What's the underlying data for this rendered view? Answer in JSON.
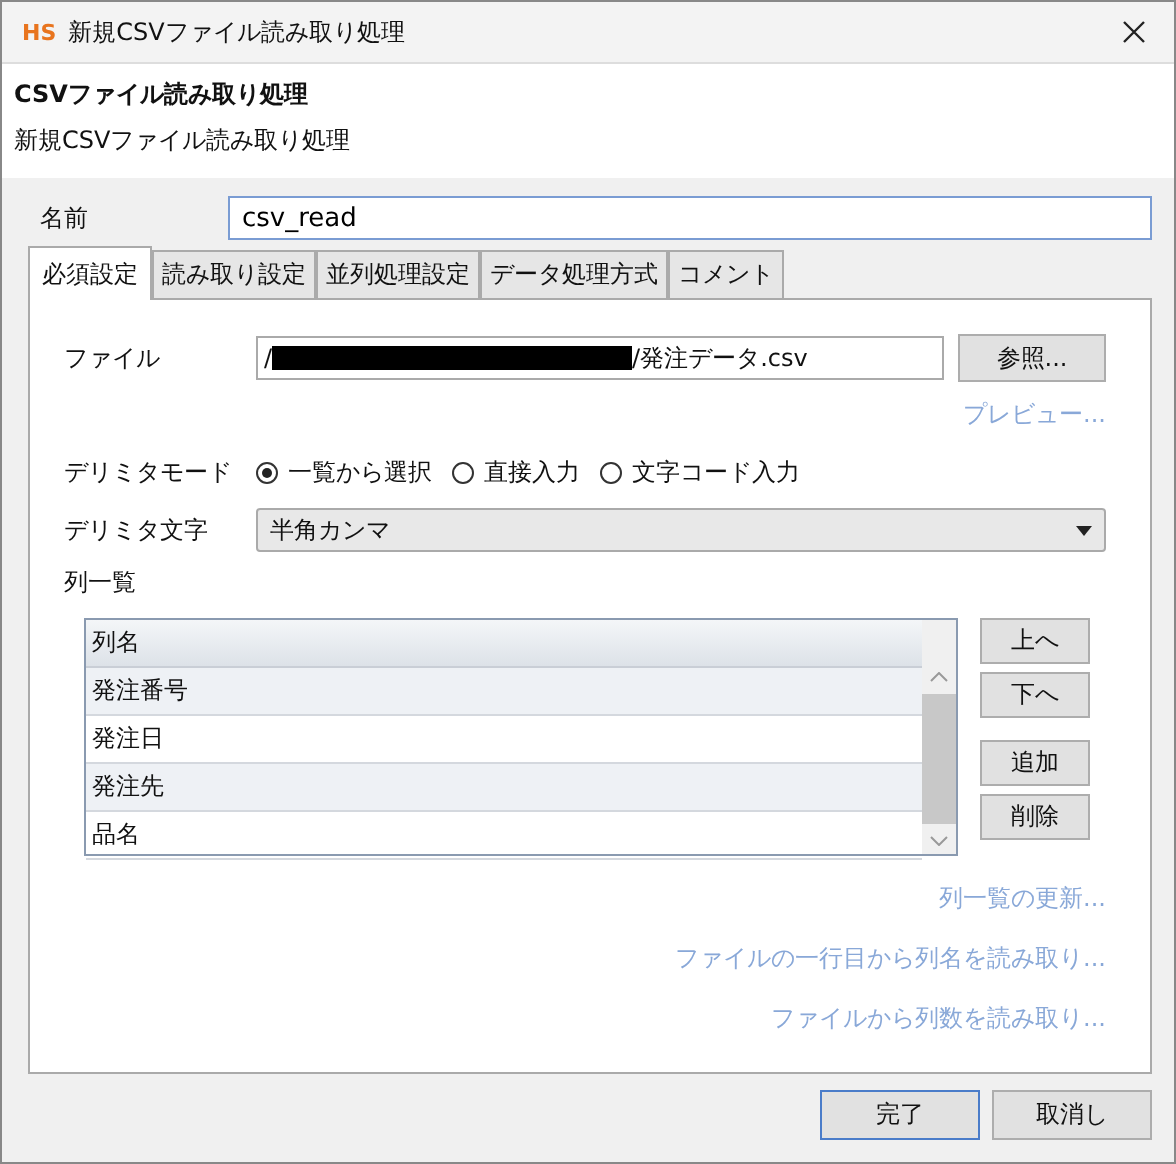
{
  "window": {
    "app_badge": "HS",
    "title": "新規CSVファイル読み取り処理"
  },
  "header": {
    "title": "CSVファイル読み取り処理",
    "subtitle": "新規CSVファイル読み取り処理"
  },
  "name_field": {
    "label": "名前",
    "value": "csv_read"
  },
  "tabs": [
    {
      "label": "必須設定",
      "selected": true
    },
    {
      "label": "読み取り設定",
      "selected": false
    },
    {
      "label": "並列処理設定",
      "selected": false
    },
    {
      "label": "データ処理方式",
      "selected": false
    },
    {
      "label": "コメント",
      "selected": false
    }
  ],
  "file": {
    "label": "ファイル",
    "value_start": "/",
    "redacted": true,
    "value_end": "/発注データ.csv",
    "browse_button": "参照...",
    "preview_link": "プレビュー..."
  },
  "delimiter_mode": {
    "label": "デリミタモード",
    "options": [
      {
        "label": "一覧から選択",
        "selected": true
      },
      {
        "label": "直接入力",
        "selected": false
      },
      {
        "label": "文字コード入力",
        "selected": false
      }
    ]
  },
  "delimiter_char": {
    "label": "デリミタ文字",
    "value": "半角カンマ"
  },
  "columns": {
    "label": "列一覧",
    "header": "列名",
    "rows": [
      "発注番号",
      "発注日",
      "発注先",
      "品名"
    ],
    "buttons": [
      "上へ",
      "下へ",
      "追加",
      "削除"
    ]
  },
  "links": [
    "列一覧の更新...",
    "ファイルの一行目から列名を読み取り...",
    "ファイルから列数を読み取り..."
  ],
  "footer_buttons": [
    {
      "label": "完了",
      "default": true
    },
    {
      "label": "取消し",
      "default": false
    }
  ]
}
